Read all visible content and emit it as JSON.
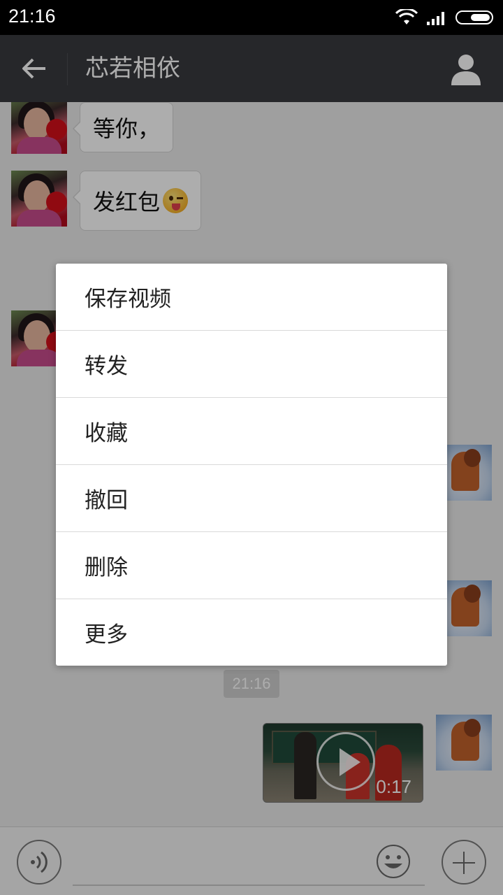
{
  "status_bar": {
    "time": "21:16",
    "icons": [
      "wifi-icon",
      "signal-icon",
      "battery-icon"
    ]
  },
  "header": {
    "title": "芯若相依",
    "back_icon": "arrow-left-icon",
    "profile_icon": "person-icon"
  },
  "chat": {
    "messages": [
      {
        "side": "left",
        "type": "text",
        "text": "等你，"
      },
      {
        "side": "left",
        "type": "text",
        "text": "发红包",
        "emoji": "wink-tongue-emoji"
      },
      {
        "side": "left",
        "type": "text",
        "text": ""
      },
      {
        "side": "right",
        "type": "text",
        "text": ""
      },
      {
        "side": "right",
        "type": "text",
        "text": ""
      },
      {
        "side": "right",
        "type": "video",
        "duration": "0:17"
      }
    ],
    "timestamp": "21:16"
  },
  "context_menu": {
    "items": [
      {
        "label": "保存视频"
      },
      {
        "label": "转发"
      },
      {
        "label": "收藏"
      },
      {
        "label": "撤回"
      },
      {
        "label": "删除"
      },
      {
        "label": "更多"
      }
    ]
  },
  "input_bar": {
    "text_value": "",
    "voice_icon": "voice-icon",
    "emoji_icon": "smiley-icon",
    "plus_icon": "plus-icon"
  },
  "colors": {
    "nav_bg": "#393a3f",
    "chat_bg": "#ebebeb",
    "status_bg": "#000000",
    "menu_bg": "#ffffff"
  }
}
